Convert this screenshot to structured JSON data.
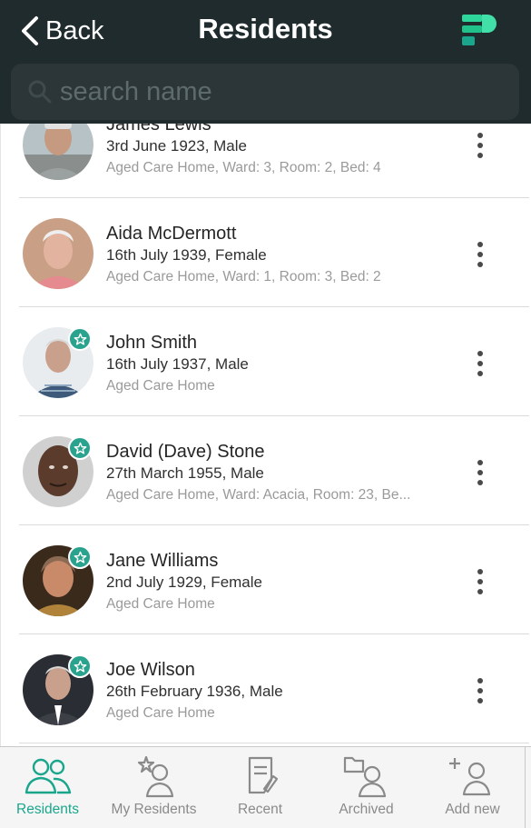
{
  "header": {
    "back_label": "Back",
    "title": "Residents"
  },
  "search": {
    "placeholder": "search name",
    "value": ""
  },
  "residents": [
    {
      "name": "James Lewis",
      "dob": "3rd June 1923, Male",
      "location": "Aged Care Home, Ward: 3, Room: 2, Bed: 4",
      "starred": false
    },
    {
      "name": "Aida McDermott",
      "dob": "16th July 1939, Female",
      "location": "Aged Care Home, Ward: 1, Room: 3, Bed: 2",
      "starred": false
    },
    {
      "name": "John Smith",
      "dob": "16th July 1937, Male",
      "location": "Aged Care Home",
      "starred": true
    },
    {
      "name": "David (Dave) Stone",
      "dob": "27th March 1955, Male",
      "location": "Aged Care Home, Ward: Acacia, Room: 23, Be...",
      "starred": true
    },
    {
      "name": "Jane Williams",
      "dob": "2nd July 1929, Female",
      "location": "Aged Care Home",
      "starred": true
    },
    {
      "name": "Joe Wilson",
      "dob": "26th February 1936, Male",
      "location": "Aged Care Home",
      "starred": true
    }
  ],
  "tabs": [
    {
      "label": "Residents",
      "icon": "residents-icon",
      "active": true
    },
    {
      "label": "My Residents",
      "icon": "my-residents-icon",
      "active": false
    },
    {
      "label": "Recent",
      "icon": "recent-icon",
      "active": false
    },
    {
      "label": "Archived",
      "icon": "archived-icon",
      "active": false
    },
    {
      "label": "Add new",
      "icon": "add-new-icon",
      "active": false
    }
  ],
  "colors": {
    "header_bg": "#1f2b2d",
    "accent": "#1aa68c",
    "badge": "#2aa38e",
    "inactive_tab": "#8a8a8a"
  }
}
